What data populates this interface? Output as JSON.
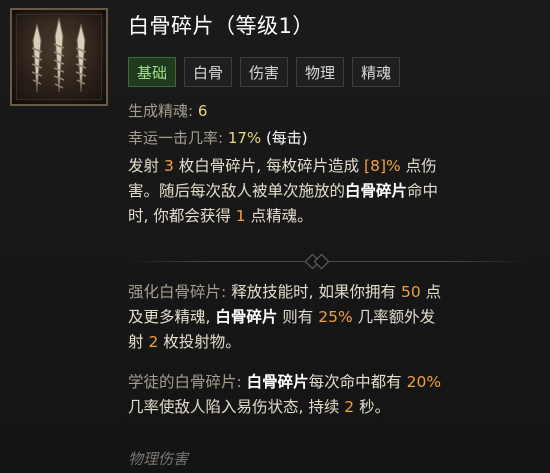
{
  "skill": {
    "icon": "bone-splinters-icon",
    "title": "白骨碎片（等级1）"
  },
  "tags": [
    "基础",
    "白骨",
    "伤害",
    "物理",
    "精魂"
  ],
  "stats": {
    "essence_label": "生成精魂: ",
    "essence_value": "6",
    "lucky_label": "幸运一击几率: ",
    "lucky_value": "17%",
    "lucky_suffix": " (每击)"
  },
  "description": {
    "l1_a": "发射 ",
    "l1_b": "3",
    "l1_c": " 枚白骨碎片, 每枚碎片造成 ",
    "l1_d": "[8]%",
    "l1_e": " 点伤",
    "l2_a": "害。随后每次敌人被单次施放的",
    "l2_b": "白骨碎片",
    "l2_c": "命中",
    "l3_a": "时, 你都会获得 ",
    "l3_b": "1",
    "l3_c": " 点精魂。"
  },
  "enhanced": {
    "l1_label": "强化白骨碎片: ",
    "l1_a": "释放技能时, 如果你拥有 ",
    "l1_b": "50",
    "l1_c": " 点",
    "l2_a": "及更多精魂, ",
    "l2_b": "白骨碎片",
    "l2_c": " 则有 ",
    "l2_d": "25%",
    "l2_e": " 几率额外发",
    "l3_a": "射 ",
    "l3_b": "2",
    "l3_c": " 枚投射物。"
  },
  "acolyte": {
    "l1_label": "学徒的白骨碎片: ",
    "l1_a": "白骨碎片",
    "l1_b": "每次命中都有 ",
    "l1_c": "20%",
    "l2_a": "几率使敌人陷入易伤状态, 持续 ",
    "l2_b": "2",
    "l2_c": " 秒。"
  },
  "damage_type": "物理伤害"
}
